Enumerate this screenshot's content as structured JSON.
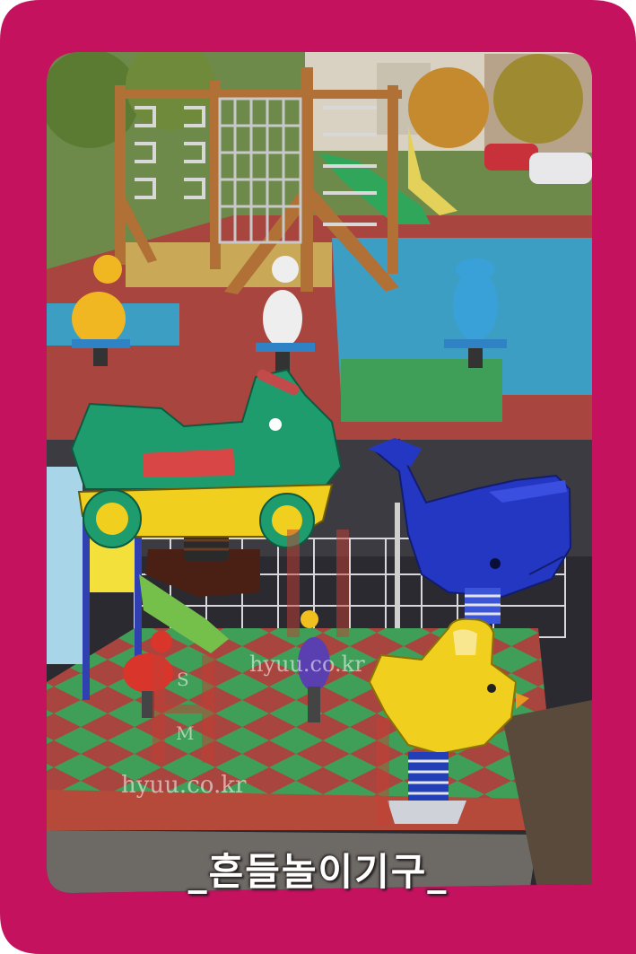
{
  "caption": "_흔들놀이기구_",
  "watermark_text": "hyuu.co.kr",
  "watermark_letters": [
    "S",
    "M"
  ],
  "colors": {
    "frame": "#c4125f",
    "rubber_red": "#a8453f",
    "rubber_blue": "#3d9ec4",
    "rubber_green": "#3f9e57",
    "toy_green": "#1e9c6e",
    "toy_yellow": "#f0cf1e",
    "toy_blue": "#2437c2"
  },
  "scene_elements": [
    "top-playground-photo",
    "bottom-playground-photo",
    "motorbike-spring-rider",
    "whale-spring-rider",
    "bird-spring-rider"
  ]
}
